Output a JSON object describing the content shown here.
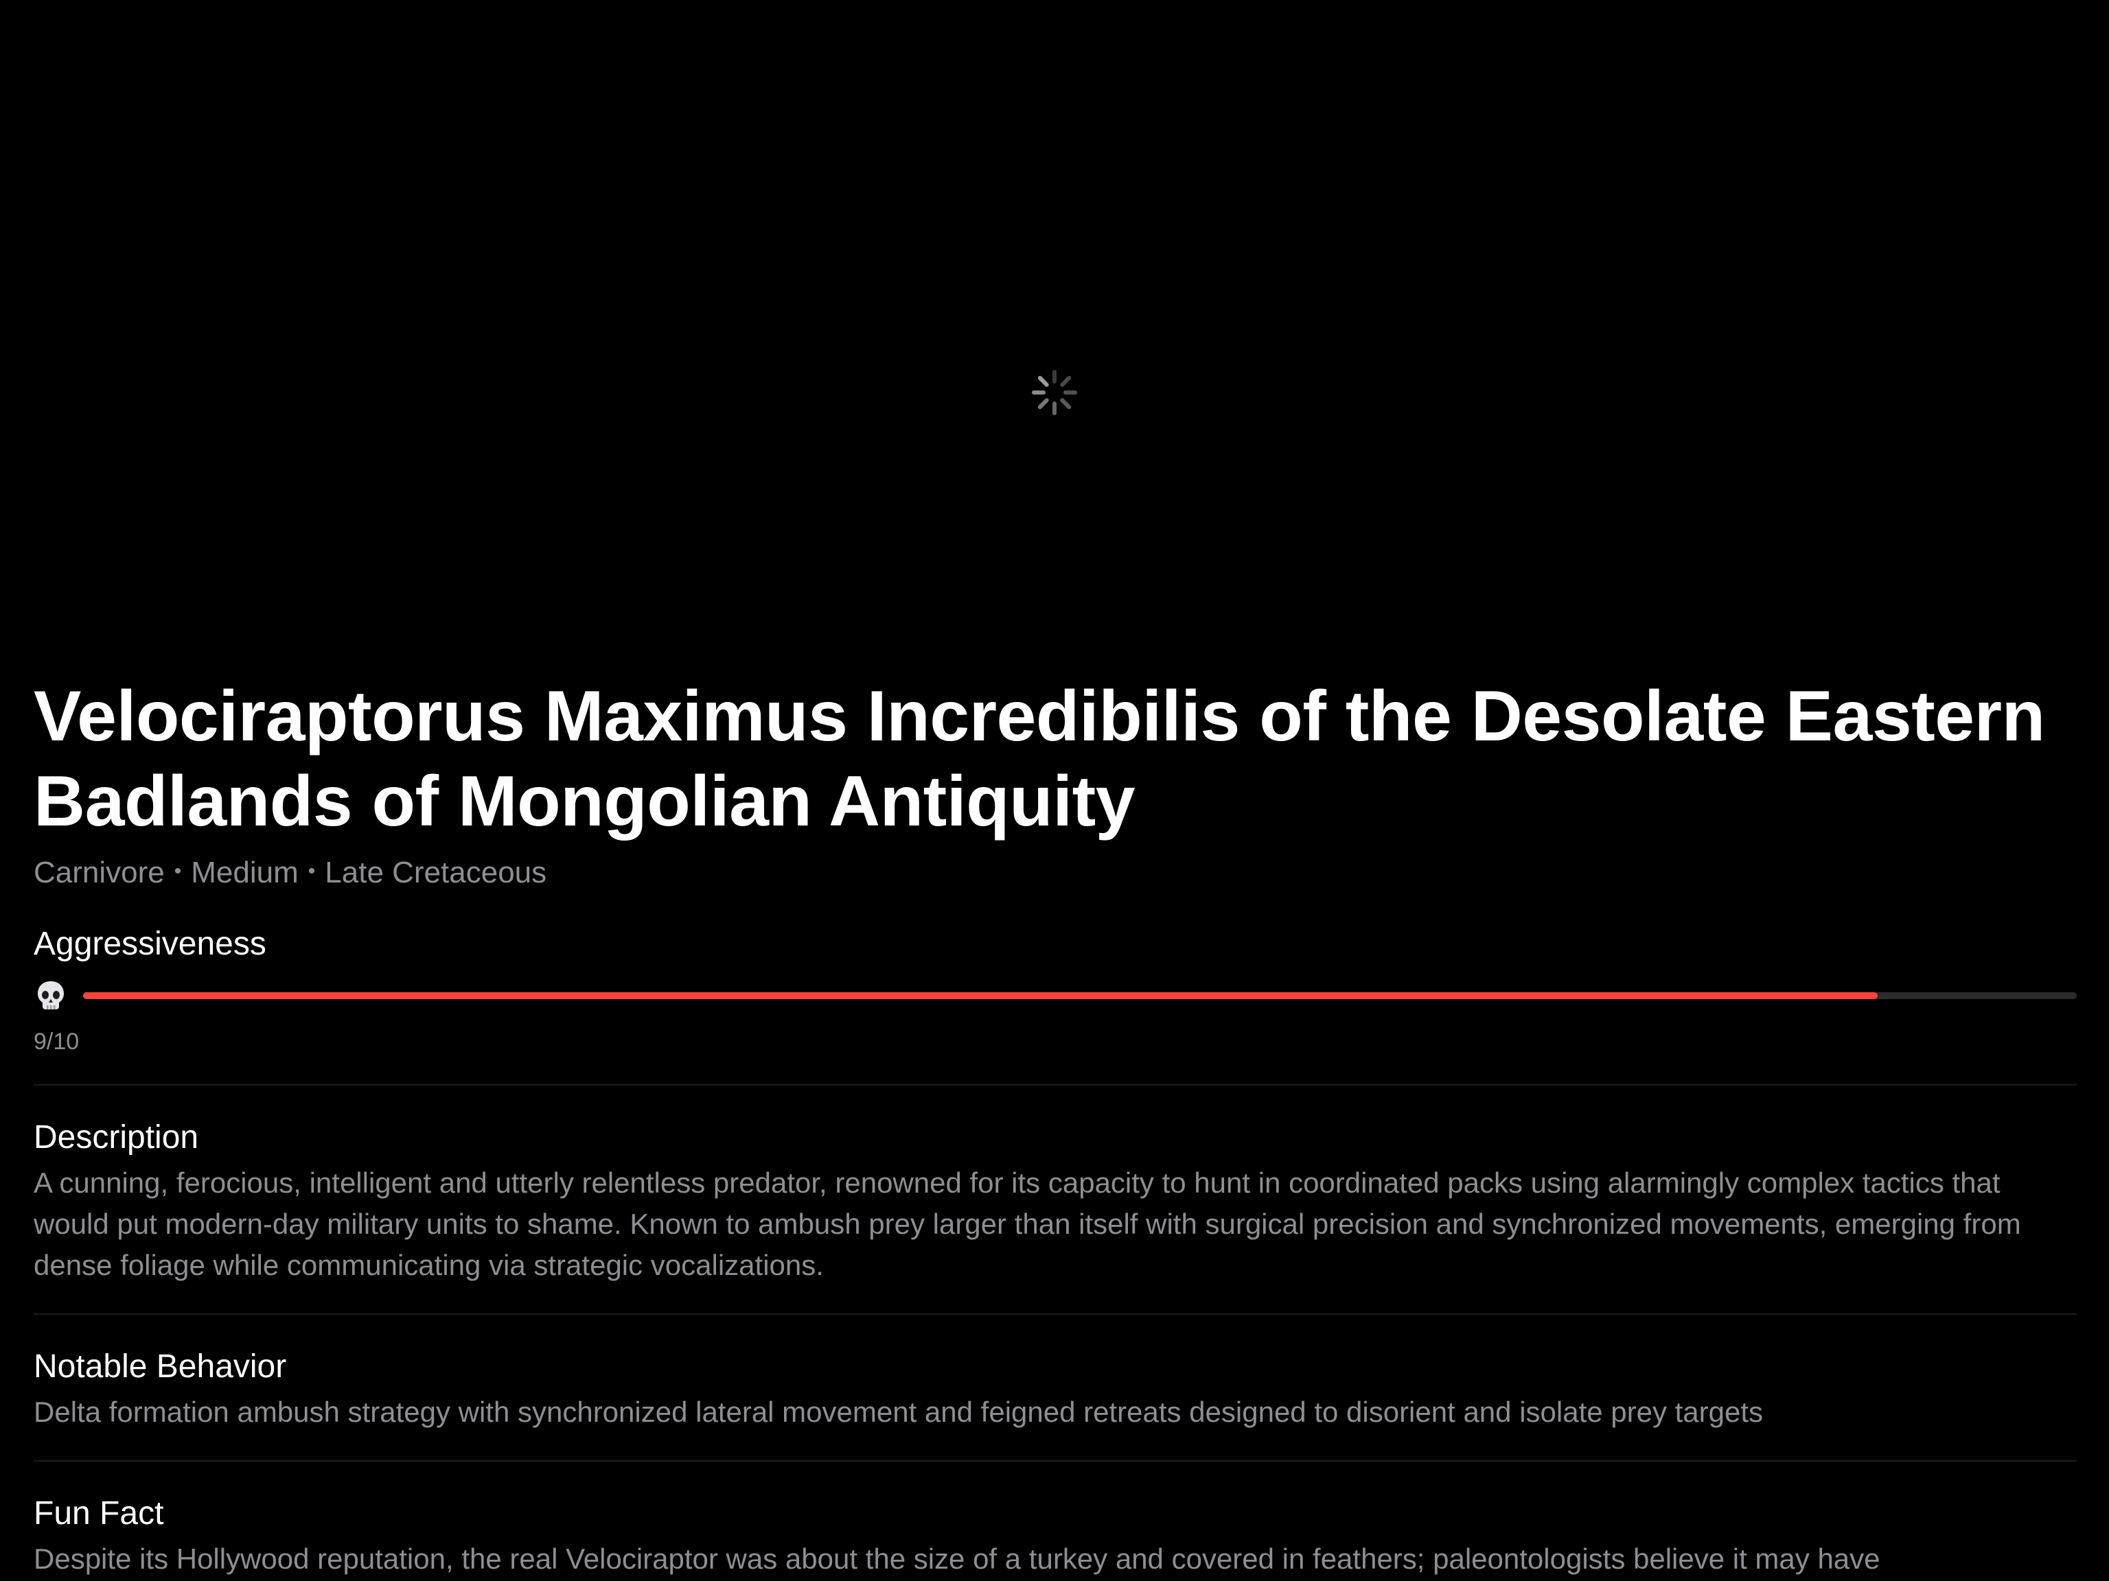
{
  "hero": {
    "state": "loading",
    "spinner_icon": "activity-indicator-icon"
  },
  "creature": {
    "name": "Velociraptorus Maximus Incredibilis of the Desolate Eastern Badlands of Mongolian Antiquity",
    "diet": "Carnivore",
    "size": "Medium",
    "period": "Late Cretaceous",
    "separator": "•"
  },
  "aggressiveness": {
    "label": "Aggressiveness",
    "icon": "skull-icon",
    "value": 9,
    "max": 10,
    "display": "9/10",
    "fill_color": "#ff453a",
    "track_color": "#2c2c2e"
  },
  "sections": {
    "description": {
      "title": "Description",
      "text": "A cunning, ferocious, intelligent and utterly relentless predator, renowned for its capacity to hunt in coordinated packs using alarmingly complex tactics that would put modern-day military units to shame. Known to ambush prey larger than itself with surgical precision and synchronized movements, emerging from dense foliage while communicating via strategic vocalizations."
    },
    "notable_behavior": {
      "title": "Notable Behavior",
      "text": "Delta formation ambush strategy with synchronized lateral movement and feigned retreats designed to disorient and isolate prey targets"
    },
    "fun_fact": {
      "title": "Fun Fact",
      "text": "Despite its Hollywood reputation, the real Velociraptor was about the size of a turkey and covered in feathers; paleontologists believe it may have"
    }
  },
  "colors": {
    "background": "#000000",
    "primary_text": "#ffffff",
    "secondary_text": "#8e8e93",
    "divider": "#1c1c1e"
  }
}
